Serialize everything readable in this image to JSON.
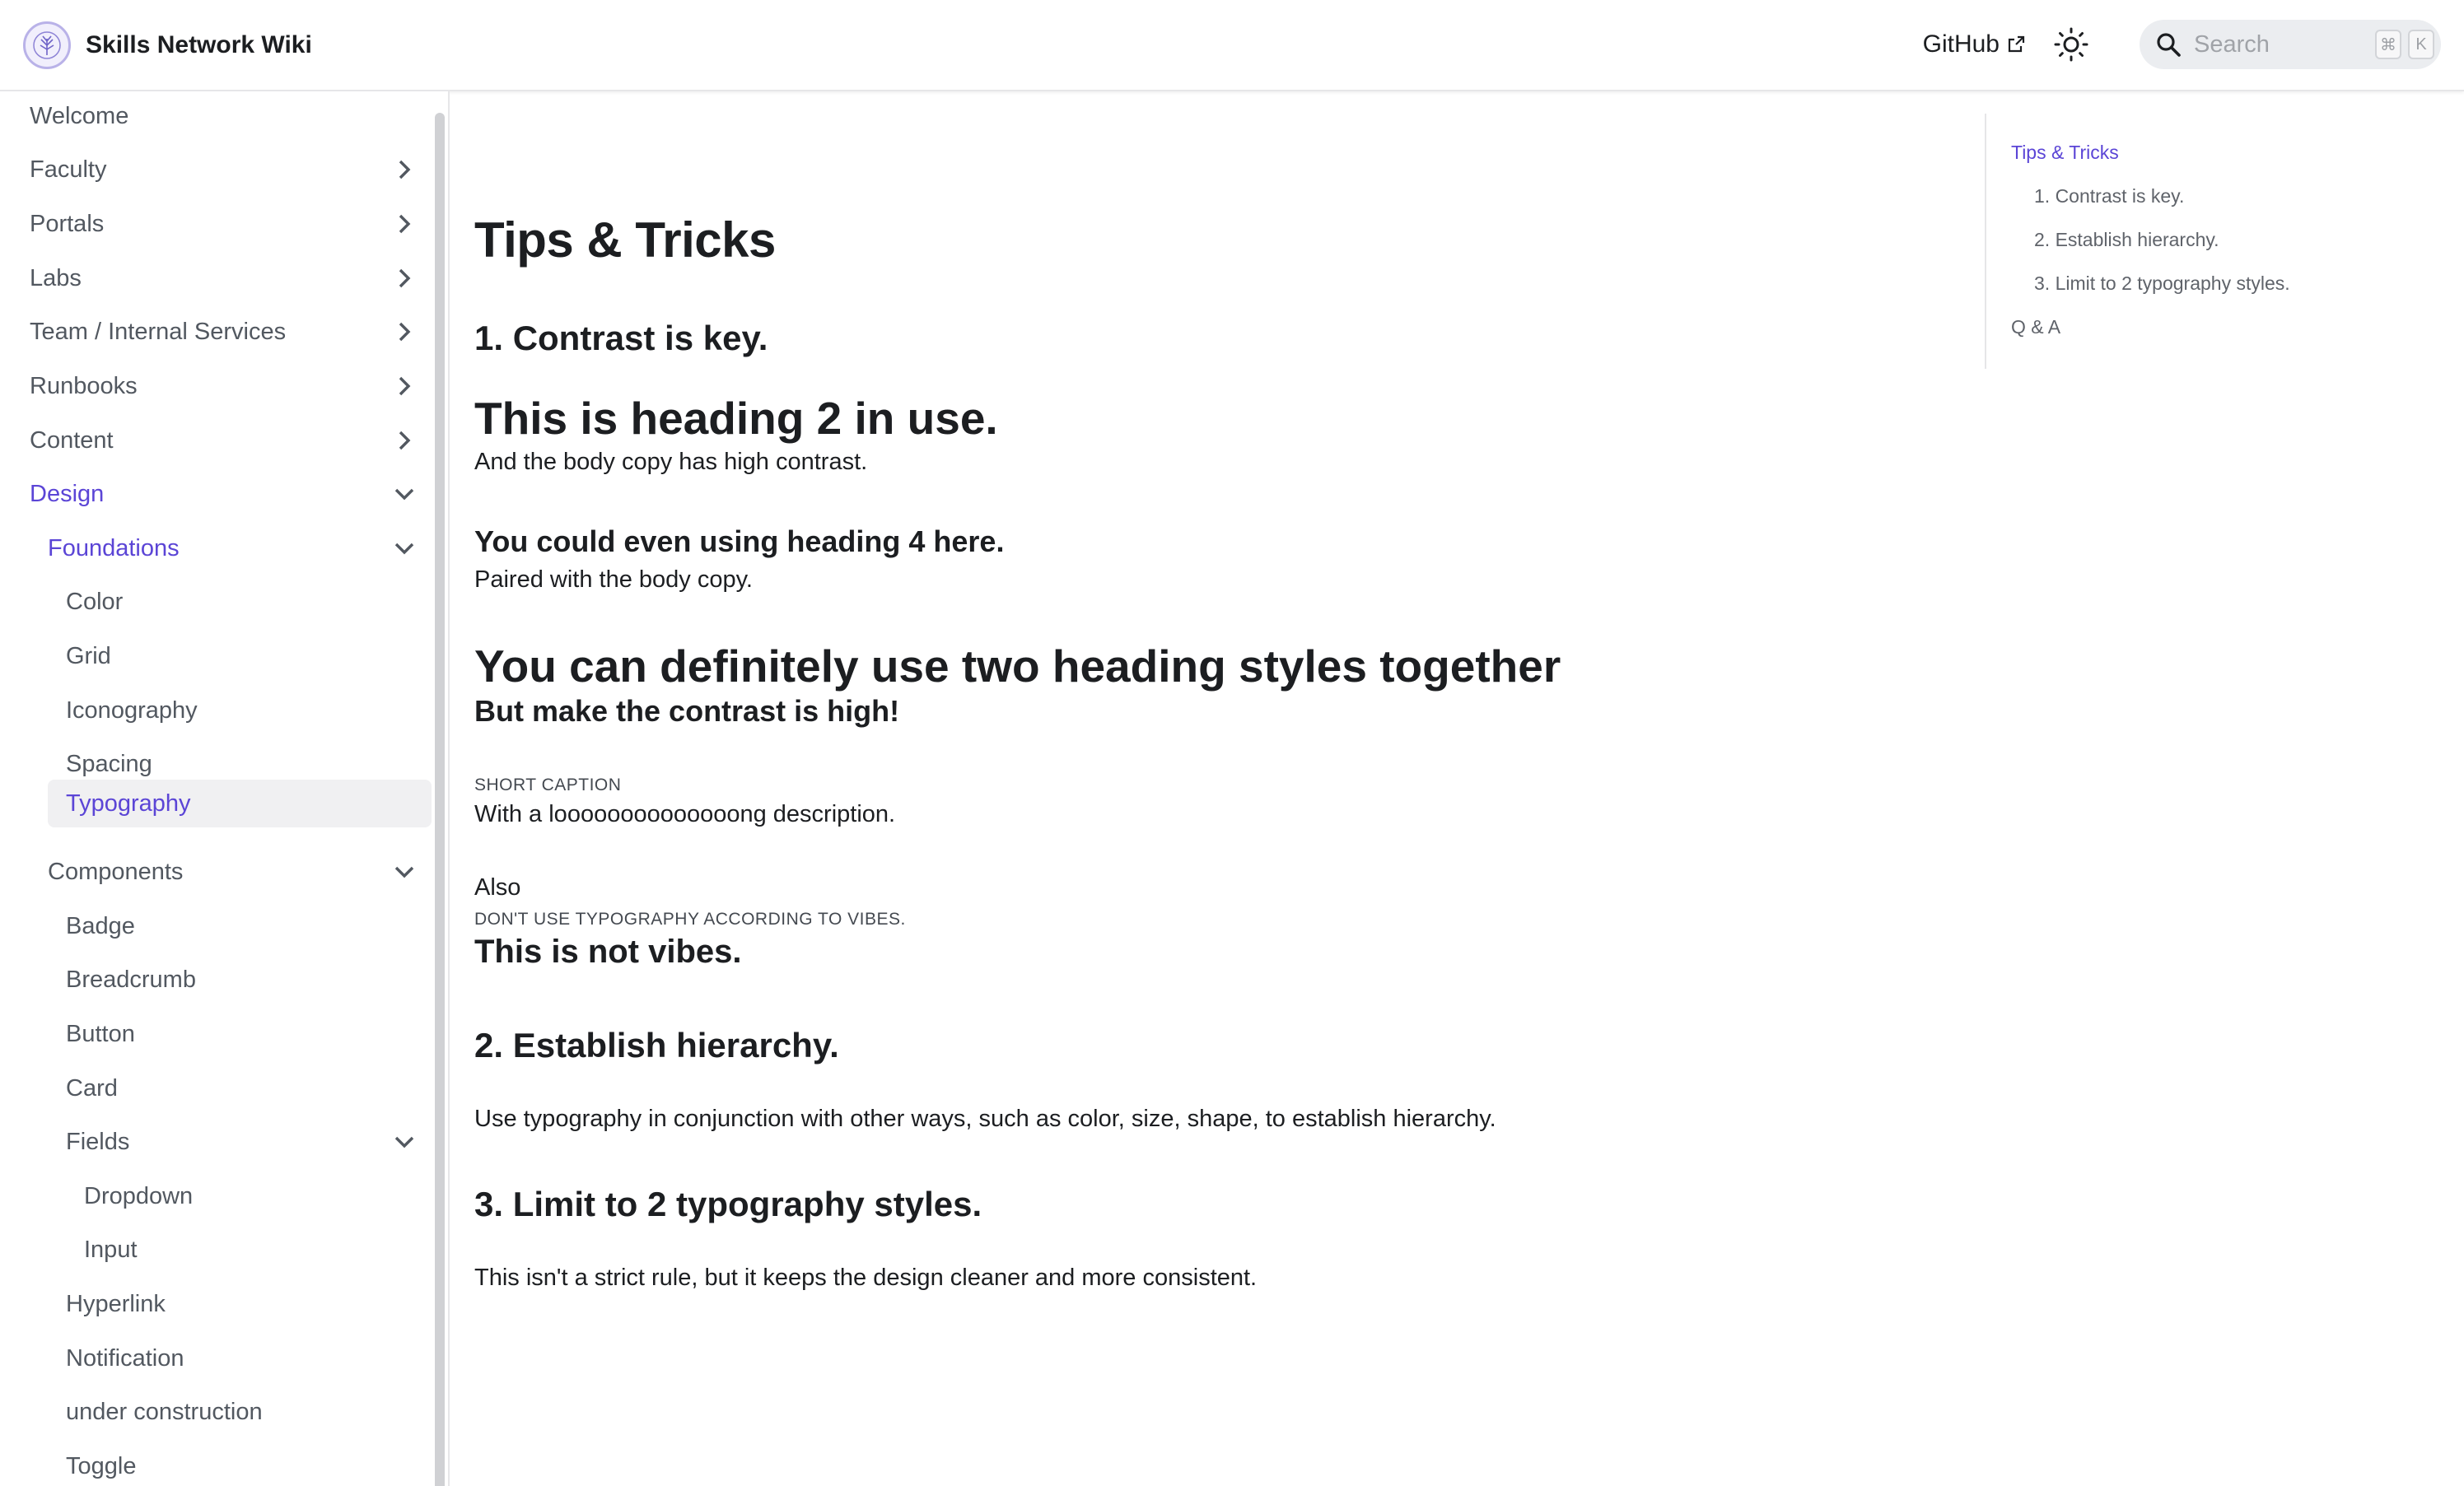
{
  "header": {
    "title": "Skills Network Wiki",
    "github_label": "GitHub",
    "search_placeholder": "Search",
    "search_shortcut": [
      "⌘",
      "K"
    ]
  },
  "sidebar": {
    "items": [
      {
        "label": "Welcome"
      },
      {
        "label": "Faculty"
      },
      {
        "label": "Portals"
      },
      {
        "label": "Labs"
      },
      {
        "label": "Team / Internal Services"
      },
      {
        "label": "Runbooks"
      },
      {
        "label": "Content"
      },
      {
        "label": "Design"
      },
      {
        "label": "Foundations"
      },
      {
        "label": "Color"
      },
      {
        "label": "Grid"
      },
      {
        "label": "Iconography"
      },
      {
        "label": "Spacing"
      },
      {
        "label": "Typography"
      },
      {
        "label": "Components"
      },
      {
        "label": "Badge"
      },
      {
        "label": "Breadcrumb"
      },
      {
        "label": "Button"
      },
      {
        "label": "Card"
      },
      {
        "label": "Fields"
      },
      {
        "label": "Dropdown"
      },
      {
        "label": "Input"
      },
      {
        "label": "Hyperlink"
      },
      {
        "label": "Notification"
      },
      {
        "label": "under construction"
      },
      {
        "label": "Toggle"
      }
    ]
  },
  "article": {
    "title": "Tips & Tricks",
    "section1_heading": "1. Contrast is key.",
    "demo_h2": "This is heading 2 in use.",
    "demo_h2_body": "And the body copy has high contrast.",
    "demo_h4": "You could even using heading 4 here.",
    "demo_h4_body": "Paired with the body copy.",
    "demo_combo_title": "You can definitely use two heading styles together",
    "demo_combo_sub": "But make the contrast is high!",
    "demo_caption": "SHORT CAPTION",
    "demo_caption_body": "With a loooooooooooooong description.",
    "also": "Also",
    "vibes_caption": "DON'T USE TYPOGRAPHY ACCORDING TO VIBES.",
    "vibes_heading": "This is not vibes.",
    "section2_heading": "2. Establish hierarchy.",
    "section2_body": "Use typography in conjunction with other ways, such as color, size, shape, to establish hierarchy.",
    "section3_heading": "3. Limit to 2 typography styles.",
    "section3_body": "This isn't a strict rule, but it keeps the design cleaner and more consistent."
  },
  "toc": {
    "items": [
      {
        "label": "Tips & Tricks"
      },
      {
        "label": "1. Contrast is key."
      },
      {
        "label": "2. Establish hierarchy."
      },
      {
        "label": "3. Limit to 2 typography styles."
      },
      {
        "label": "Q & A"
      }
    ]
  },
  "colors": {
    "accent": "#5b45d6",
    "text": "#1c1e21",
    "sidebar_text": "#525860",
    "selected_bg": "#f0f0f2"
  }
}
